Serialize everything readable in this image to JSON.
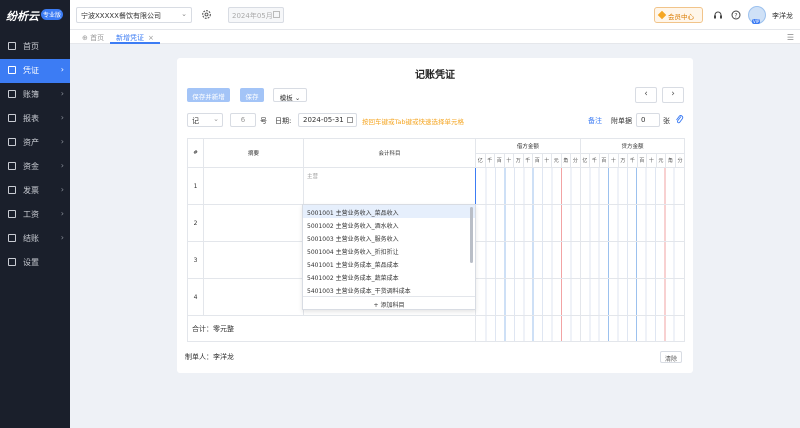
{
  "app": {
    "logo_text": "纷析云",
    "edition_badge": "专业版"
  },
  "header": {
    "company": "宁波XXXXX餐饮有限公司",
    "period": "2024年05月",
    "member_center": "会员中心",
    "user_name": "李洋龙",
    "avatar_badge": "VIP"
  },
  "sidebar": {
    "items": [
      {
        "label": "首页",
        "icon": "home-icon",
        "has_arrow": false
      },
      {
        "label": "凭证",
        "icon": "voucher-icon",
        "has_arrow": true,
        "active": true
      },
      {
        "label": "账簿",
        "icon": "ledger-icon",
        "has_arrow": true
      },
      {
        "label": "报表",
        "icon": "report-icon",
        "has_arrow": true
      },
      {
        "label": "资产",
        "icon": "asset-icon",
        "has_arrow": true
      },
      {
        "label": "资金",
        "icon": "fund-icon",
        "has_arrow": true
      },
      {
        "label": "发票",
        "icon": "invoice-icon",
        "has_arrow": true
      },
      {
        "label": "工资",
        "icon": "salary-icon",
        "has_arrow": true
      },
      {
        "label": "结账",
        "icon": "closing-icon",
        "has_arrow": true
      },
      {
        "label": "设置",
        "icon": "settings-icon",
        "has_arrow": false
      }
    ]
  },
  "tabs": [
    {
      "label": "首页"
    },
    {
      "label": "新增凭证",
      "active": true
    }
  ],
  "voucher": {
    "title": "记账凭证",
    "save_and_new": "保存并新增",
    "save": "保存",
    "template": "模板",
    "word": "记",
    "number": "6",
    "number_unit": "号",
    "date_label": "日期:",
    "date_value": "2024-05-31",
    "hint": "按回车键或Tab键或快速选择单元格",
    "note_link": "备注",
    "attach_label": "附单据",
    "attach_count": "0",
    "attach_unit": "张",
    "columns": {
      "index": "#",
      "summary": "摘要",
      "account": "会计科目",
      "debit": "借方金额",
      "credit": "贷方金额"
    },
    "digits": [
      "亿",
      "千",
      "百",
      "十",
      "万",
      "千",
      "百",
      "十",
      "元",
      "角",
      "分"
    ],
    "rows": [
      "1",
      "2",
      "3",
      "4"
    ],
    "account_placeholder": "主营",
    "total_label": "合计：零元整",
    "maker_label": "制单人：",
    "maker_name": "李洋龙",
    "clear_button": "清除"
  },
  "dropdown": {
    "items": [
      "5001001 主营业务收入_菜品收入",
      "5001002 主营业务收入_酒水收入",
      "5001003 主营业务收入_服务收入",
      "5001004 主营业务收入_折扣折让",
      "5401001 主营业务成本_菜品成本",
      "5401002 主营业务成本_蔬菜成本",
      "5401003 主营业务成本_干货调料成本"
    ],
    "add_label": "添加科目"
  },
  "colors": {
    "accent": "#3c7cf4",
    "sidebar_bg": "#1a1f2b",
    "hint": "#f5a623"
  }
}
